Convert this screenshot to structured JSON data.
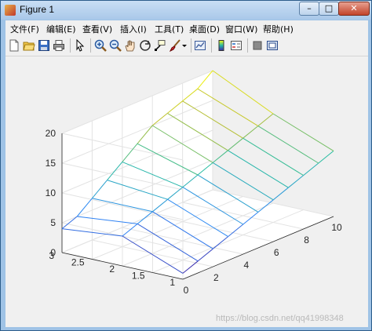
{
  "window": {
    "title": "Figure 1",
    "minimize": "–",
    "maximize": "□",
    "close": "✕"
  },
  "menu": [
    {
      "id": "file",
      "label": "文件(F)"
    },
    {
      "id": "edit",
      "label": "编辑(E)"
    },
    {
      "id": "view",
      "label": "查看(V)"
    },
    {
      "id": "insert",
      "label": "插入(I)"
    },
    {
      "id": "tools",
      "label": "工具(T)"
    },
    {
      "id": "desktop",
      "label": "桌面(D)"
    },
    {
      "id": "window",
      "label": "窗口(W)"
    },
    {
      "id": "help",
      "label": "帮助(H)"
    }
  ],
  "toolbar": [
    {
      "name": "new-figure-icon"
    },
    {
      "name": "open-file-icon"
    },
    {
      "name": "save-icon"
    },
    {
      "name": "print-icon"
    },
    {
      "name": "pointer-icon"
    },
    {
      "name": "zoom-in-icon"
    },
    {
      "name": "zoom-out-icon"
    },
    {
      "name": "pan-hand-icon"
    },
    {
      "name": "rotate-3d-icon"
    },
    {
      "name": "data-cursor-icon"
    },
    {
      "name": "brush-icon"
    },
    {
      "name": "brush-dropdown-icon"
    },
    {
      "name": "link-plot-icon"
    },
    {
      "name": "colorbar-icon"
    },
    {
      "name": "legend-icon"
    },
    {
      "name": "hide-plot-tools-icon"
    },
    {
      "name": "show-plot-tools-icon"
    }
  ],
  "watermark": "https://blog.csdn.net/qq41998348",
  "chart_data": {
    "type": "mesh",
    "x": [
      0,
      1,
      2,
      3,
      4,
      5,
      6,
      7,
      8,
      9,
      10
    ],
    "y": [
      1,
      2,
      3
    ],
    "z_formula": "z = x + y (planar for y=1..2), fold ridge at y=2",
    "z": [
      [
        1,
        2,
        3,
        4,
        5,
        6,
        7,
        8,
        9,
        10,
        11
      ],
      [
        5,
        6,
        7,
        8,
        9,
        10,
        11,
        12,
        13,
        14,
        15
      ],
      [
        4,
        5,
        7,
        9,
        11,
        13,
        15,
        16,
        17,
        18,
        20
      ]
    ],
    "xticks": [
      "0",
      "2",
      "4",
      "6",
      "8",
      "10"
    ],
    "yticks": [
      "1",
      "1.5",
      "2",
      "2.5",
      "3"
    ],
    "zticks": [
      "0",
      "5",
      "10",
      "15",
      "20"
    ],
    "xlim": [
      0,
      10
    ],
    "ylim": [
      1,
      3
    ],
    "zlim": [
      0,
      20
    ],
    "grid": true,
    "colormap": "parula"
  }
}
